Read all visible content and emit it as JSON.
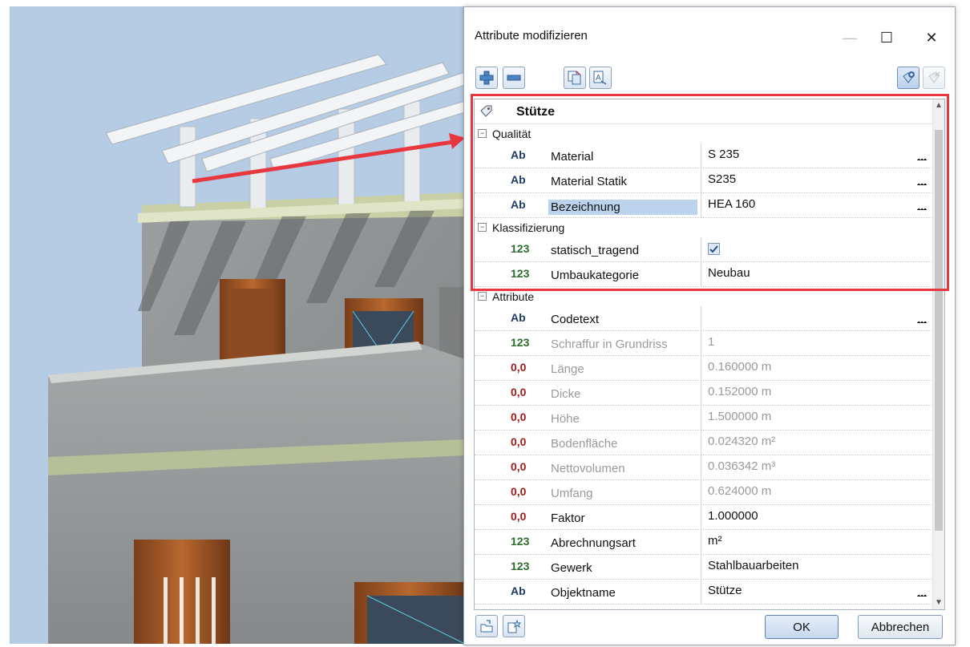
{
  "dialog": {
    "title": "Attribute modifizieren",
    "window_buttons": {
      "minimize": "—",
      "maximize": "☐",
      "close": "✕"
    }
  },
  "toolbar": {
    "buttons": [
      {
        "icon": "add-attribute-icon"
      },
      {
        "icon": "remove-attribute-icon"
      },
      {
        "icon": "copy-attributes-icon"
      },
      {
        "icon": "transfer-attributes-icon"
      },
      {
        "icon": "favorite-add-icon",
        "state": "active"
      },
      {
        "icon": "favorite-remove-icon",
        "state": "disabled"
      }
    ]
  },
  "object_header": {
    "label": "Stütze"
  },
  "sections": [
    {
      "label": "Qualität",
      "toggle": "−",
      "rows": [
        {
          "type": "Ab",
          "name": "Material",
          "value": "S 235",
          "more": "..."
        },
        {
          "type": "Ab",
          "name": "Material Statik",
          "value": "S235",
          "more": "..."
        },
        {
          "type": "Ab",
          "name": "Bezeichnung",
          "value": "HEA 160",
          "more": "...",
          "selected": true
        }
      ]
    },
    {
      "label": "Klassifizierung",
      "toggle": "−",
      "rows": [
        {
          "type": "123",
          "name": "statisch_tragend",
          "checkbox": true,
          "checked": true
        },
        {
          "type": "123",
          "name": "Umbaukategorie",
          "value": "Neubau"
        }
      ]
    },
    {
      "label": "Attribute",
      "toggle": "−",
      "rows": [
        {
          "type": "Ab",
          "name": "Codetext",
          "value": "",
          "more": "..."
        },
        {
          "type": "123",
          "name": "Schraffur in Grundriss",
          "value": "1",
          "readonly": true
        },
        {
          "type": "0,0",
          "name": "Länge",
          "value": "0.160000 m",
          "readonly": true
        },
        {
          "type": "0,0",
          "name": "Dicke",
          "value": "0.152000 m",
          "readonly": true
        },
        {
          "type": "0,0",
          "name": "Höhe",
          "value": "1.500000 m",
          "readonly": true
        },
        {
          "type": "0,0",
          "name": "Bodenfläche",
          "value": "0.024320 m²",
          "readonly": true
        },
        {
          "type": "0,0",
          "name": "Nettovolumen",
          "value": "0.036342 m³",
          "readonly": true
        },
        {
          "type": "0,0",
          "name": "Umfang",
          "value": "0.624000 m",
          "readonly": true
        },
        {
          "type": "0,0",
          "name": "Faktor",
          "value": "1.000000"
        },
        {
          "type": "123",
          "name": "Abrechnungsart",
          "value": "m²"
        },
        {
          "type": "123",
          "name": "Gewerk",
          "value": "Stahlbauarbeiten"
        },
        {
          "type": "Ab",
          "name": "Objektname",
          "value": "Stütze",
          "more": "..."
        }
      ]
    }
  ],
  "footer": {
    "ok_label": "OK",
    "cancel_label": "Abbrechen",
    "icons": [
      "export-icon",
      "import-icon"
    ]
  },
  "colors": {
    "highlight": "#e8373e",
    "type_text": "#1f3d66",
    "type_int": "#2c6b2c",
    "type_float": "#9a1b1b",
    "selection": "#bcd3ee"
  }
}
